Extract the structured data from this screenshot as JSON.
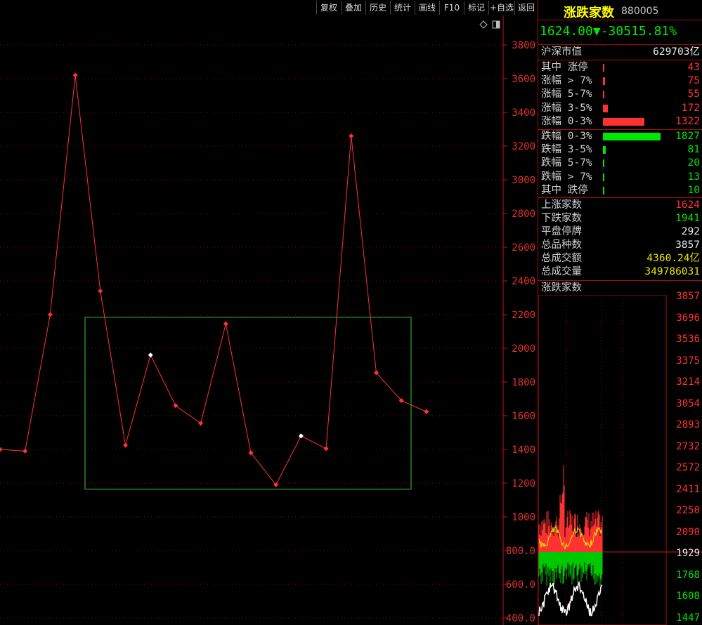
{
  "toolbar": {
    "buttons": [
      "复权",
      "叠加",
      "历史",
      "统计",
      "画线",
      "F10",
      "标记",
      "+自选",
      "返回"
    ]
  },
  "main_chart": {
    "y_ticks": [
      "3800",
      "3600",
      "3400",
      "3200",
      "3000",
      "2800",
      "2600",
      "2400",
      "2200",
      "2000",
      "1800",
      "1600",
      "1400",
      "1200",
      "1000",
      "800.0",
      "600.0",
      "400.0"
    ]
  },
  "chart_data": {
    "type": "line",
    "ylim": [
      350,
      3950
    ],
    "values": [
      1400,
      1390,
      2200,
      3620,
      2340,
      1425,
      1960,
      1660,
      1555,
      2145,
      1380,
      1190,
      1480,
      1405,
      3260,
      1855,
      1690,
      1624
    ],
    "ticks": [
      3800,
      3600,
      3400,
      3200,
      3000,
      2800,
      2600,
      2400,
      2200,
      2000,
      1800,
      1600,
      1400,
      1200,
      1000,
      800,
      600,
      400
    ],
    "highlight_points": [
      6,
      12
    ],
    "series_color": "#ff3232",
    "box_color": "#33cc33"
  },
  "panel": {
    "title": "涨跌家数",
    "code": "880005",
    "price": "1624.00",
    "arrow": "▼",
    "change": "-305",
    "pct": "15.81%",
    "market_value_label": "沪深市值",
    "market_value": "629703亿",
    "up_rows": [
      {
        "label": "其中 涨停",
        "value": "43",
        "ratio": 0.02
      },
      {
        "label": "涨幅 > 7%",
        "value": "75",
        "ratio": 0.04
      },
      {
        "label": "涨幅 5-7%",
        "value": "55",
        "ratio": 0.03
      },
      {
        "label": "涨幅 3-5%",
        "value": "172",
        "ratio": 0.09
      },
      {
        "label": "涨幅 0-3%",
        "value": "1322",
        "ratio": 0.72
      }
    ],
    "down_rows": [
      {
        "label": "跌幅 0-3%",
        "value": "1827",
        "ratio": 1.0
      },
      {
        "label": "跌幅 3-5%",
        "value": "81",
        "ratio": 0.045
      },
      {
        "label": "跌幅 5-7%",
        "value": "20",
        "ratio": 0.012
      },
      {
        "label": "跌幅 > 7%",
        "value": "13",
        "ratio": 0.008
      },
      {
        "label": "其中 跌停",
        "value": "10",
        "ratio": 0.006
      }
    ],
    "stats": [
      {
        "label": "上涨家数",
        "value": "1624",
        "color": "red"
      },
      {
        "label": "下跌家数",
        "value": "1941",
        "color": "green"
      },
      {
        "label": "平盘停牌",
        "value": "292",
        "color": "white"
      },
      {
        "label": "总品种数",
        "value": "3857",
        "color": "white"
      },
      {
        "label": "总成交额",
        "value": "4360.24亿",
        "color": "yellow"
      },
      {
        "label": "总成交量",
        "value": "349786031",
        "color": "yellow"
      }
    ],
    "mini_title": "涨跌家数",
    "mini_ticks": [
      {
        "label": "3857",
        "color": "red"
      },
      {
        "label": "3696",
        "color": "red"
      },
      {
        "label": "3536",
        "color": "red"
      },
      {
        "label": "3375",
        "color": "red"
      },
      {
        "label": "3214",
        "color": "red"
      },
      {
        "label": "3054",
        "color": "red"
      },
      {
        "label": "2893",
        "color": "red"
      },
      {
        "label": "2732",
        "color": "red"
      },
      {
        "label": "2572",
        "color": "red"
      },
      {
        "label": "2411",
        "color": "red"
      },
      {
        "label": "2250",
        "color": "red"
      },
      {
        "label": "2090",
        "color": "red"
      },
      {
        "label": "1929",
        "color": "white"
      },
      {
        "label": "1768",
        "color": "green"
      },
      {
        "label": "1608",
        "color": "green"
      },
      {
        "label": "1447",
        "color": "green"
      }
    ]
  }
}
